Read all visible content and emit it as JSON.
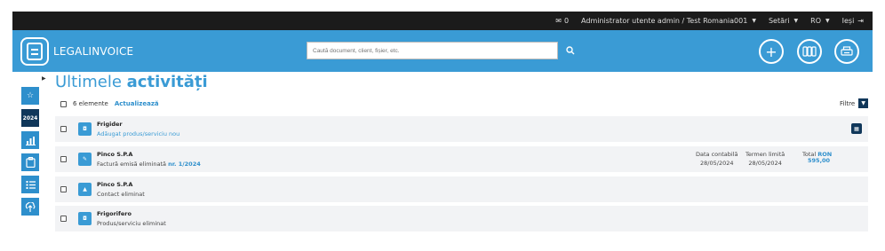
{
  "topbar": {
    "messages_count": "0",
    "user": "Administrator utente admin / Test Romania001",
    "settings": "Setări",
    "language": "RO",
    "logout": "Ieși"
  },
  "header": {
    "brand": "LEGALINVOICE",
    "search_placeholder": "Caută document, client, fișier, etc."
  },
  "sidebar": {
    "year": "2024"
  },
  "page": {
    "title_light": "Ultimele",
    "title_bold": "activități",
    "count": "6 elemente",
    "refresh": "Actualizează",
    "filter": "Filtre"
  },
  "rows": [
    {
      "title": "Frigider",
      "subtitle": "Adăugat produs/serviciu nou",
      "icon": "box-icon"
    },
    {
      "title": "Pinco S.P.A",
      "subtitle": "Factură emisă eliminată",
      "number": "nr. 1/2024",
      "icon": "invoice-icon",
      "date_label": "Data contabilă",
      "date_value": "28/05/2024",
      "due_label": "Termen limită",
      "due_value": "28/05/2024",
      "total_label": "Total",
      "currency": "RON",
      "total_value": "595,00"
    },
    {
      "title": "Pinco S.P.A",
      "subtitle": "Contact eliminat",
      "icon": "contact-icon"
    },
    {
      "title": "Frigorifero",
      "subtitle": "Produs/serviciu eliminat",
      "icon": "box-icon"
    }
  ]
}
